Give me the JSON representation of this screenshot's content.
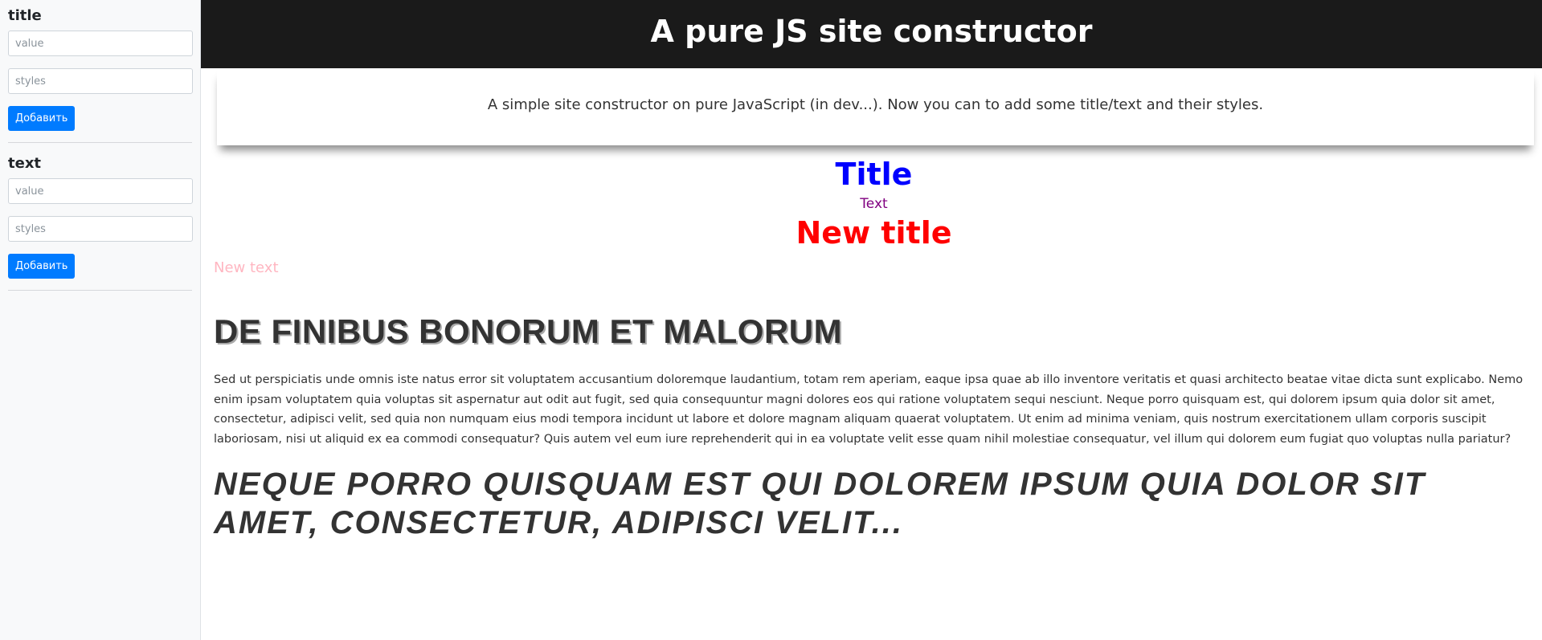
{
  "sidebar": {
    "title_panel": {
      "heading": "title",
      "value_placeholder": "value",
      "styles_placeholder": "styles",
      "button_label": "Добавить"
    },
    "text_panel": {
      "heading": "text",
      "value_placeholder": "value",
      "styles_placeholder": "styles",
      "button_label": "Добавить"
    }
  },
  "header": {
    "title": "A pure JS site constructor"
  },
  "intro": {
    "text": "A simple site constructor on pure JavaScript (in dev...). Now you can to add some title/text and their styles."
  },
  "content": {
    "title1": "Title",
    "text1": "Text",
    "title2": "New title",
    "text2": "New text",
    "heading": "DE FINIBUS BONORUM ET MALORUM",
    "paragraph": "Sed ut perspiciatis unde omnis iste natus error sit voluptatem accusantium doloremque laudantium, totam rem aperiam, eaque ipsa quae ab illo inventore veritatis et quasi architecto beatae vitae dicta sunt explicabo. Nemo enim ipsam voluptatem quia voluptas sit aspernatur aut odit aut fugit, sed quia consequuntur magni dolores eos qui ratione voluptatem sequi nesciunt. Neque porro quisquam est, qui dolorem ipsum quia dolor sit amet, consectetur, adipisci velit, sed quia non numquam eius modi tempora incidunt ut labore et dolore magnam aliquam quaerat voluptatem. Ut enim ad minima veniam, quis nostrum exercitationem ullam corporis suscipit laboriosam, nisi ut aliquid ex ea commodi consequatur? Quis autem vel eum iure reprehenderit qui in ea voluptate velit esse quam nihil molestiae consequatur, vel illum qui dolorem eum fugiat quo voluptas nulla pariatur?",
    "italic_heading": "NEQUE PORRO QUISQUAM EST QUI DOLOREM IPSUM QUIA DOLOR SIT AMET, CONSECTETUR, ADIPISCI VELIT..."
  },
  "colors": {
    "header_bg": "#1a1a1a",
    "button": "#007bff",
    "title1": "#0000ff",
    "text1": "#800080",
    "title2": "#ff0000",
    "text2": "#ffb6c1"
  }
}
